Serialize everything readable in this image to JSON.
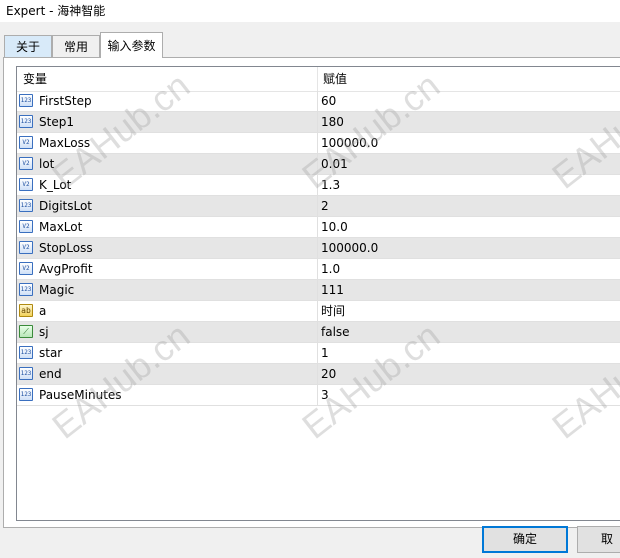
{
  "window": {
    "title": "Expert - 海神智能"
  },
  "tabs": [
    {
      "label": "关于"
    },
    {
      "label": "常用"
    },
    {
      "label": "输入参数"
    }
  ],
  "grid": {
    "columns": {
      "variable": "变量",
      "value": "赋值"
    },
    "rows": [
      {
        "name": "FirstStep",
        "value": "60",
        "type_icon": "integer-icon"
      },
      {
        "name": "Step1",
        "value": "180",
        "type_icon": "integer-icon"
      },
      {
        "name": "MaxLoss",
        "value": "100000.0",
        "type_icon": "double-icon"
      },
      {
        "name": "lot",
        "value": "0.01",
        "type_icon": "double-icon"
      },
      {
        "name": "K_Lot",
        "value": "1.3",
        "type_icon": "double-icon"
      },
      {
        "name": "DigitsLot",
        "value": "2",
        "type_icon": "integer-icon"
      },
      {
        "name": "MaxLot",
        "value": "10.0",
        "type_icon": "double-icon"
      },
      {
        "name": "StopLoss",
        "value": "100000.0",
        "type_icon": "double-icon"
      },
      {
        "name": "AvgProfit",
        "value": "1.0",
        "type_icon": "double-icon"
      },
      {
        "name": "Magic",
        "value": "111",
        "type_icon": "integer-icon"
      },
      {
        "name": "a",
        "value": "时间",
        "type_icon": "string-icon"
      },
      {
        "name": "sj",
        "value": "false",
        "type_icon": "boolean-icon"
      },
      {
        "name": "star",
        "value": "1",
        "type_icon": "integer-icon"
      },
      {
        "name": "end",
        "value": "20",
        "type_icon": "integer-icon"
      },
      {
        "name": "PauseMinutes",
        "value": "3",
        "type_icon": "integer-icon"
      }
    ]
  },
  "buttons": {
    "ok": "确定",
    "cancel": "取"
  },
  "watermark": "EAHub.cn"
}
